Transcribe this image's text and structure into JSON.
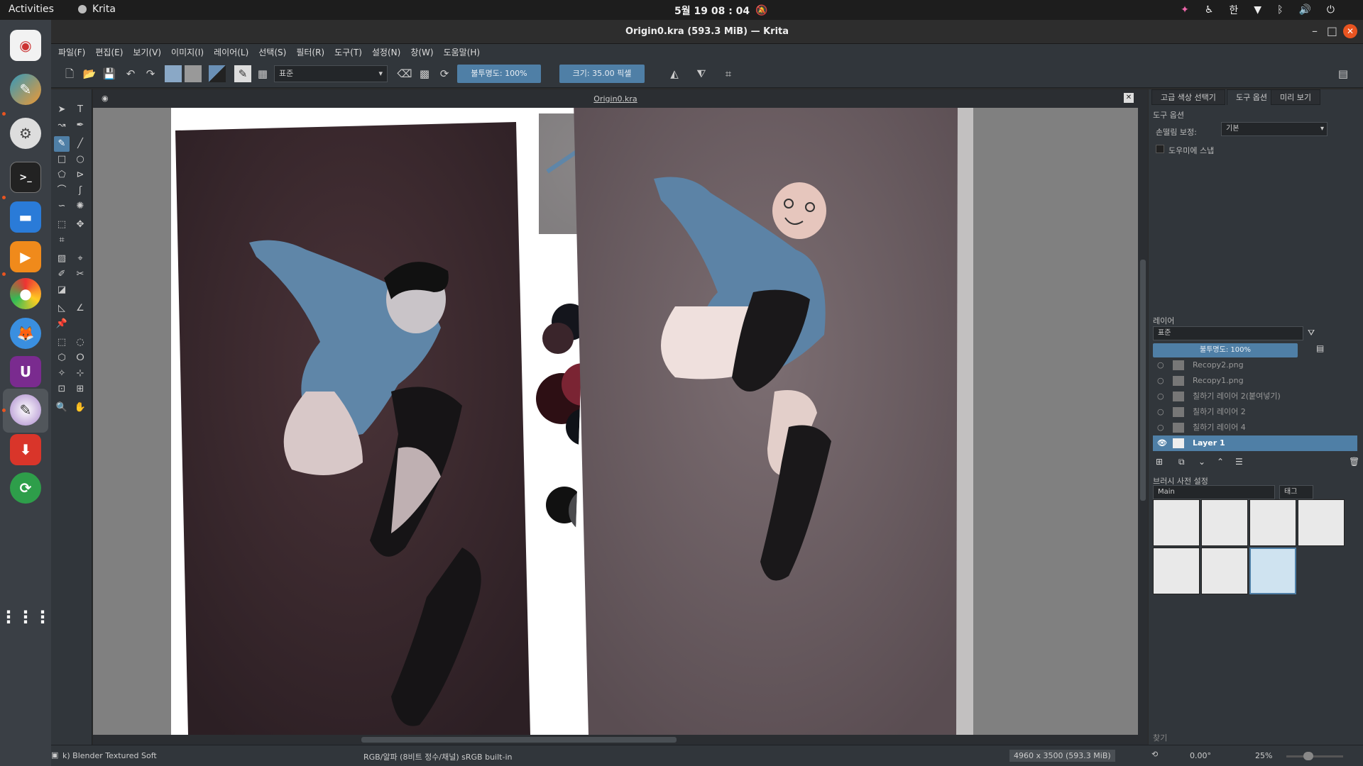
{
  "topbar": {
    "activities": "Activities",
    "app_name": "Krita",
    "clock": "5월 19 08 : 04",
    "input_method": "한"
  },
  "window": {
    "title": "Origin0.kra (593.3 MiB) — Krita"
  },
  "menu": [
    "파일(F)",
    "편집(E)",
    "보기(V)",
    "이미지(I)",
    "레이어(L)",
    "선택(S)",
    "필터(R)",
    "도구(T)",
    "설정(N)",
    "창(W)",
    "도움말(H)"
  ],
  "toolbar": {
    "blend_mode": "표준",
    "opacity": "불투명도: 100%",
    "size": "크기: 35.00 픽셀"
  },
  "document": {
    "tab_title": "Origin0.kra"
  },
  "docker": {
    "tabs": [
      "고급 색상 선택기",
      "도구 옵션",
      "미리 보기"
    ],
    "tool_options_title": "도구 옵션",
    "smoothing_label": "손떨림 보정:",
    "smoothing_value": "기본",
    "snap_label": "도우미에 스냅",
    "layers_title": "레이어",
    "layers_blend": "표준",
    "layers_opacity": "불투명도: 100%",
    "layers": [
      {
        "name": "Recopy2.png",
        "visible": false,
        "active": false
      },
      {
        "name": "Recopy1.png",
        "visible": false,
        "active": false
      },
      {
        "name": "칠하기 레이어 2(붙여넣기)",
        "visible": false,
        "active": false
      },
      {
        "name": "칠하기 레이어 2",
        "visible": false,
        "active": false
      },
      {
        "name": "칠하기 레이어 4",
        "visible": false,
        "active": false
      },
      {
        "name": "Layer 1",
        "visible": true,
        "active": true
      }
    ],
    "brush_presets_title": "브러시 사전 설정",
    "brush_tag": "Main",
    "tag_button": "태그",
    "search_placeholder": "찾기"
  },
  "status": {
    "brush": "k) Blender Textured Soft",
    "color_space": "RGB/알파 (8비트 정수/채널)  sRGB built-in",
    "image_size": "4960 x 3500 (593.3 MiB)",
    "rotation": "0.00°",
    "zoom": "25%"
  },
  "colors": {
    "accent": "#4f7fa6",
    "ubuntu_orange": "#e95420"
  }
}
